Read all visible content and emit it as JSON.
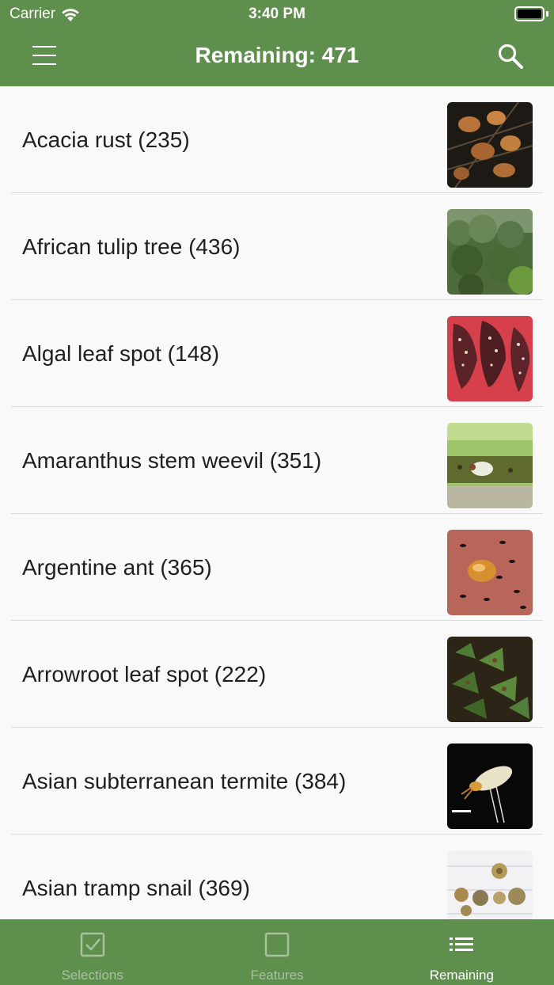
{
  "status": {
    "carrier": "Carrier",
    "time": "3:40 PM"
  },
  "nav": {
    "title": "Remaining: 471",
    "menu_icon": "hamburger-menu-icon",
    "search_icon": "search-icon"
  },
  "items": [
    {
      "label": "Acacia rust (235)",
      "thumb": "acacia-rust-photo"
    },
    {
      "label": "African tulip tree (436)",
      "thumb": "african-tulip-tree-photo"
    },
    {
      "label": "Algal leaf spot (148)",
      "thumb": "algal-leaf-spot-photo"
    },
    {
      "label": "Amaranthus stem weevil (351)",
      "thumb": "amaranthus-stem-weevil-photo"
    },
    {
      "label": "Argentine ant (365)",
      "thumb": "argentine-ant-photo"
    },
    {
      "label": "Arrowroot leaf spot (222)",
      "thumb": "arrowroot-leaf-spot-photo"
    },
    {
      "label": "Asian subterranean termite (384)",
      "thumb": "asian-subterranean-termite-photo"
    },
    {
      "label": "Asian tramp snail (369)",
      "thumb": "asian-tramp-snail-photo"
    }
  ],
  "tabs": [
    {
      "label": "Selections",
      "icon": "checked-square-icon",
      "active": false
    },
    {
      "label": "Features",
      "icon": "empty-square-icon",
      "active": false
    },
    {
      "label": "Remaining",
      "icon": "list-icon",
      "active": true
    }
  ],
  "colors": {
    "bar_green": "#5f8f4d",
    "inactive_tab": "#a8c39c",
    "active_tab": "#ffffff"
  }
}
